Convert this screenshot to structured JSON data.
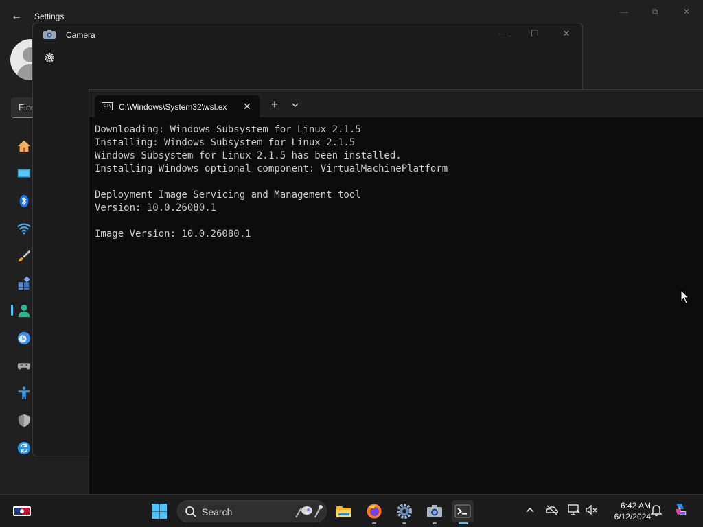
{
  "settings": {
    "title": "Settings",
    "search_placeholder": "Find",
    "nav_icons": [
      "home-icon",
      "system-icon",
      "bluetooth-icon",
      "network-icon",
      "personalization-icon",
      "apps-icon",
      "accounts-icon",
      "time-language-icon",
      "gaming-icon",
      "accessibility-icon",
      "privacy-security-icon",
      "windows-update-icon"
    ]
  },
  "camera": {
    "title": "Camera"
  },
  "terminal": {
    "tab_title": "C:\\Windows\\System32\\wsl.ex",
    "output": "Downloading: Windows Subsystem for Linux 2.1.5\nInstalling: Windows Subsystem for Linux 2.1.5\nWindows Subsystem for Linux 2.1.5 has been installed.\nInstalling Windows optional component: VirtualMachinePlatform\n\nDeployment Image Servicing and Management tool\nVersion: 10.0.26080.1\n\nImage Version: 10.0.26080.1"
  },
  "taskbar": {
    "search_label": "Search",
    "time": "6:42 AM",
    "date": "6/12/2024",
    "pinned": [
      "start-icon",
      "file-explorer-icon",
      "firefox-icon",
      "settings-icon",
      "camera-icon",
      "terminal-icon"
    ],
    "accent": "#4cc2ff"
  }
}
